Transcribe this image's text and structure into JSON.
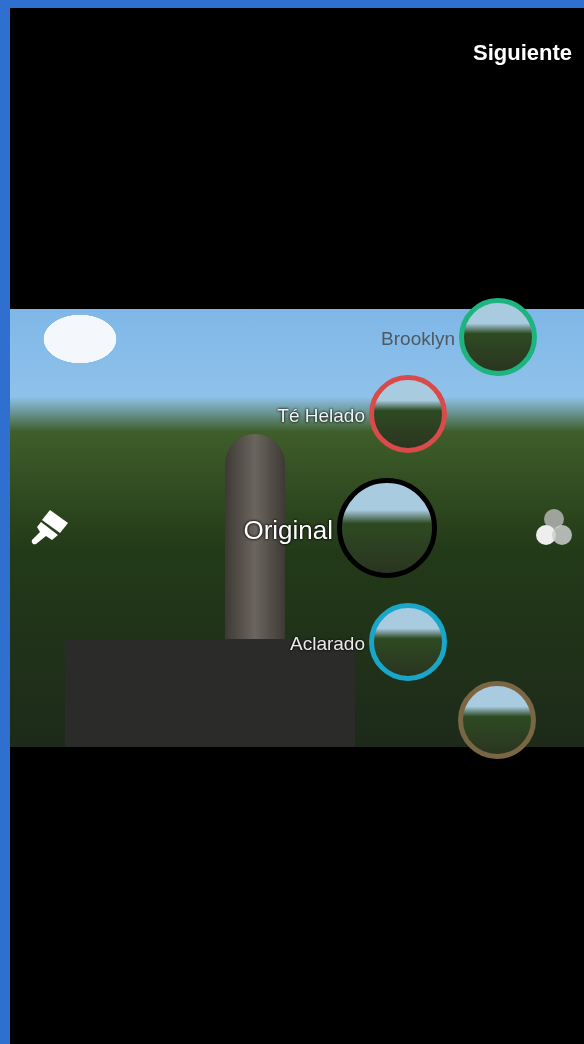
{
  "header": {
    "next_button": "Siguiente"
  },
  "filters": [
    {
      "label": "Brooklyn",
      "color": "#1db47f",
      "selected": false
    },
    {
      "label": "Té Helado",
      "color": "#d94a4a",
      "selected": false
    },
    {
      "label": "Original",
      "color": "#000000",
      "selected": true
    },
    {
      "label": "Aclarado",
      "color": "#1aa6c9",
      "selected": false
    },
    {
      "color": "#7a6642",
      "selected": false
    }
  ]
}
